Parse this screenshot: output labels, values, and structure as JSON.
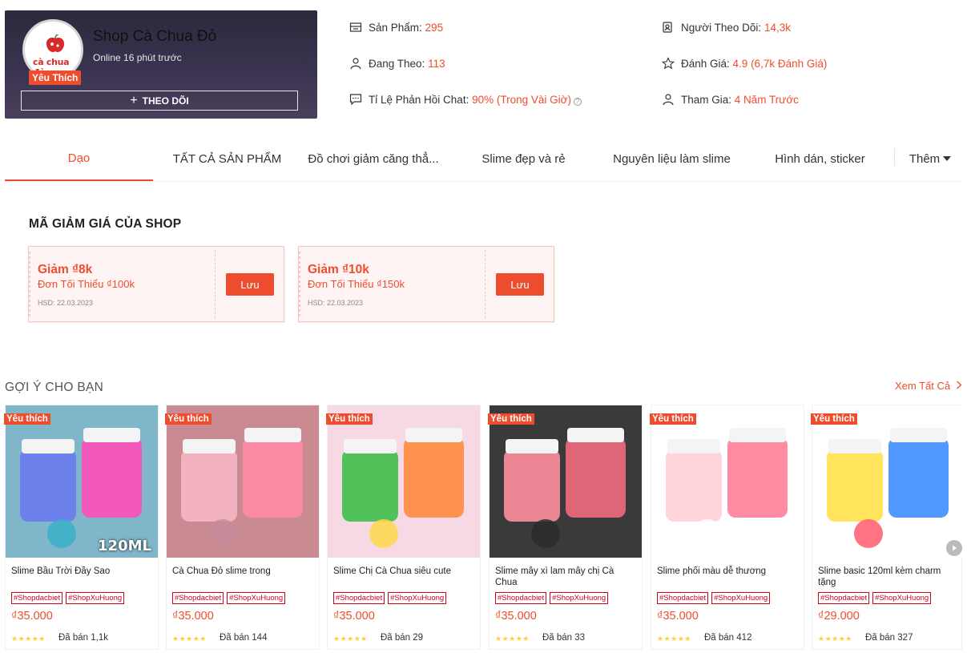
{
  "shop": {
    "name": "Shop Cà Chua Đỏ",
    "online": "Online 16 phút trước",
    "logo_text": "cà chua đỏ",
    "badge": "Yêu Thích",
    "follow_label": "THEO DÕI"
  },
  "stats": [
    {
      "label": "Sản Phẩm: ",
      "value": "295",
      "icon": "store-icon"
    },
    {
      "label": "Người Theo Dõi: ",
      "value": "14,3k",
      "icon": "followers-icon"
    },
    {
      "label": "Đang Theo: ",
      "value": "113",
      "icon": "following-icon"
    },
    {
      "label": "Đánh Giá: ",
      "value": "4.9 (6,7k Đánh Giá)",
      "icon": "star-icon"
    },
    {
      "label": "Tỉ Lệ Phản Hồi Chat: ",
      "value": "90% (Trong Vài Giờ)",
      "icon": "chat-icon"
    },
    {
      "label": "Tham Gia: ",
      "value": "4 Năm Trước",
      "icon": "user-icon"
    }
  ],
  "tabs": [
    "Dạo",
    "TẤT CẢ SẢN PHẨM",
    "Đồ chơi giảm căng thẳ...",
    "Slime đẹp và rẻ",
    "Nguyên liệu làm slime",
    "Hình dán, sticker",
    "Thêm"
  ],
  "vouchers_title": "MÃ GIẢM GIÁ CỦA SHOP",
  "vouchers": [
    {
      "title": "Giảm ₫8k",
      "min": "Đơn Tối Thiểu ₫100k",
      "expiry": "HSD: 22.03.2023",
      "button": "Lưu"
    },
    {
      "title": "Giảm ₫10k",
      "min": "Đơn Tối Thiểu ₫150k",
      "expiry": "HSD: 22.03.2023",
      "button": "Lưu"
    }
  ],
  "recommend": {
    "title": "GỢI Ý CHO BẠN",
    "see_all": "Xem Tất Cả",
    "products": [
      {
        "badge": "Yêu thích",
        "name": "Slime Bầu Trời Đầy Sao",
        "tags": [
          "#Shopdacbiet",
          "#ShopXuHuong"
        ],
        "price": "₫35.000",
        "sold": "Đã bán 1,1k",
        "image_caption": "120ML",
        "colors": [
          "#6b7bf0",
          "#ff4fb8",
          "#3ab0c8"
        ]
      },
      {
        "badge": "Yêu thích",
        "name": "Cà Chua Đỏ slime trong",
        "tags": [
          "#Shopdacbiet",
          "#ShopXuHuong"
        ],
        "price": "₫35.000",
        "sold": "Đã bán 144",
        "image_caption": "",
        "colors": [
          "#f6b6c4",
          "#ff8aa5",
          "#c78a9a"
        ]
      },
      {
        "badge": "Yêu thích",
        "name": "Slime Chị Cà Chua siêu cute",
        "tags": [
          "#Shopdacbiet",
          "#ShopXuHuong"
        ],
        "price": "₫35.000",
        "sold": "Đã bán 29",
        "image_caption": "",
        "colors": [
          "#3fbf4a",
          "#ff8a3d",
          "#ffd84a"
        ]
      },
      {
        "badge": "Yêu thích",
        "name": "Slime mây xì lam mây chị Cà Chua",
        "tags": [
          "#Shopdacbiet",
          "#ShopXuHuong"
        ],
        "price": "₫35.000",
        "sold": "Đã bán 33",
        "image_caption": "",
        "colors": [
          "#ff8fa0",
          "#f26c7e",
          "#2b2b2b"
        ]
      },
      {
        "badge": "Yêu thích",
        "name": "Slime phối màu dễ thương",
        "tags": [
          "#Shopdacbiet",
          "#ShopXuHuong"
        ],
        "price": "₫35.000",
        "sold": "Đã bán 412",
        "image_caption": "",
        "colors": [
          "#ffd0d8",
          "#ff7f98",
          "#ffffff"
        ]
      },
      {
        "badge": "Yêu thích",
        "name": "Slime basic 120ml kèm charm tặng",
        "tags": [
          "#Shopdacbiet",
          "#ShopXuHuong"
        ],
        "price": "₫29.000",
        "sold": "Đã bán 327",
        "image_caption": "",
        "colors": [
          "#ffe14a",
          "#3d8cff",
          "#ff5a6e"
        ]
      }
    ]
  }
}
